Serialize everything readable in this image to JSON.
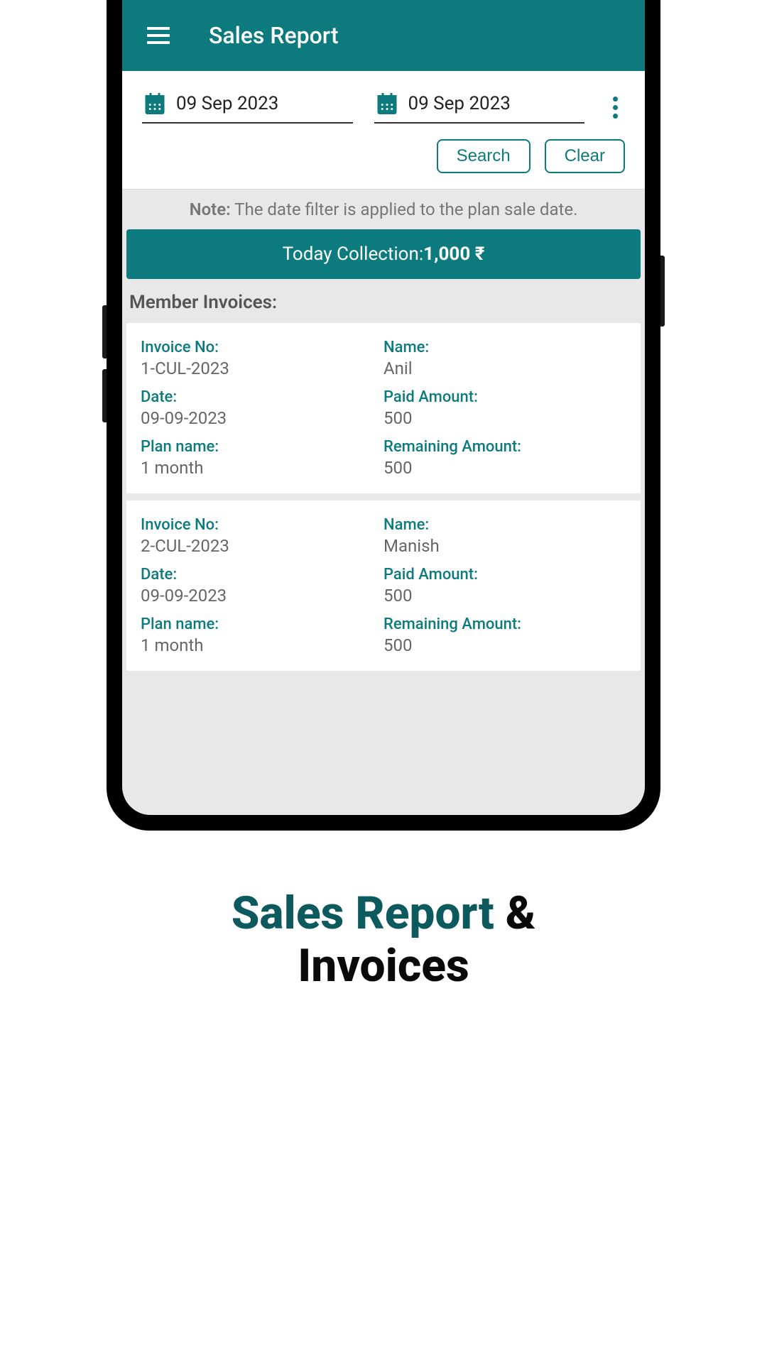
{
  "header": {
    "title": "Sales Report"
  },
  "filter": {
    "start_date": "09 Sep 2023",
    "end_date": "09 Sep 2023",
    "search_label": "Search",
    "clear_label": "Clear"
  },
  "note": {
    "label": "Note:",
    "text": " The date filter is applied to the plan sale date."
  },
  "collection": {
    "label": "Today Collection:",
    "amount": "1,000 ₹"
  },
  "section_title": "Member Invoices:",
  "labels": {
    "invoice_no": "Invoice No:",
    "name": "Name:",
    "date": "Date:",
    "paid_amount": "Paid Amount:",
    "plan_name": "Plan name:",
    "remaining_amount": "Remaining Amount:"
  },
  "invoices": [
    {
      "invoice_no": "1-CUL-2023",
      "name": "Anil",
      "date": "09-09-2023",
      "paid_amount": "500",
      "plan_name": "1 month",
      "remaining_amount": "500"
    },
    {
      "invoice_no": "2-CUL-2023",
      "name": "Manish",
      "date": "09-09-2023",
      "paid_amount": "500",
      "plan_name": "1 month",
      "remaining_amount": "500"
    }
  ],
  "marketing": {
    "line1a": "Sales Report",
    "line1b": " &",
    "line2": "Invoices"
  }
}
